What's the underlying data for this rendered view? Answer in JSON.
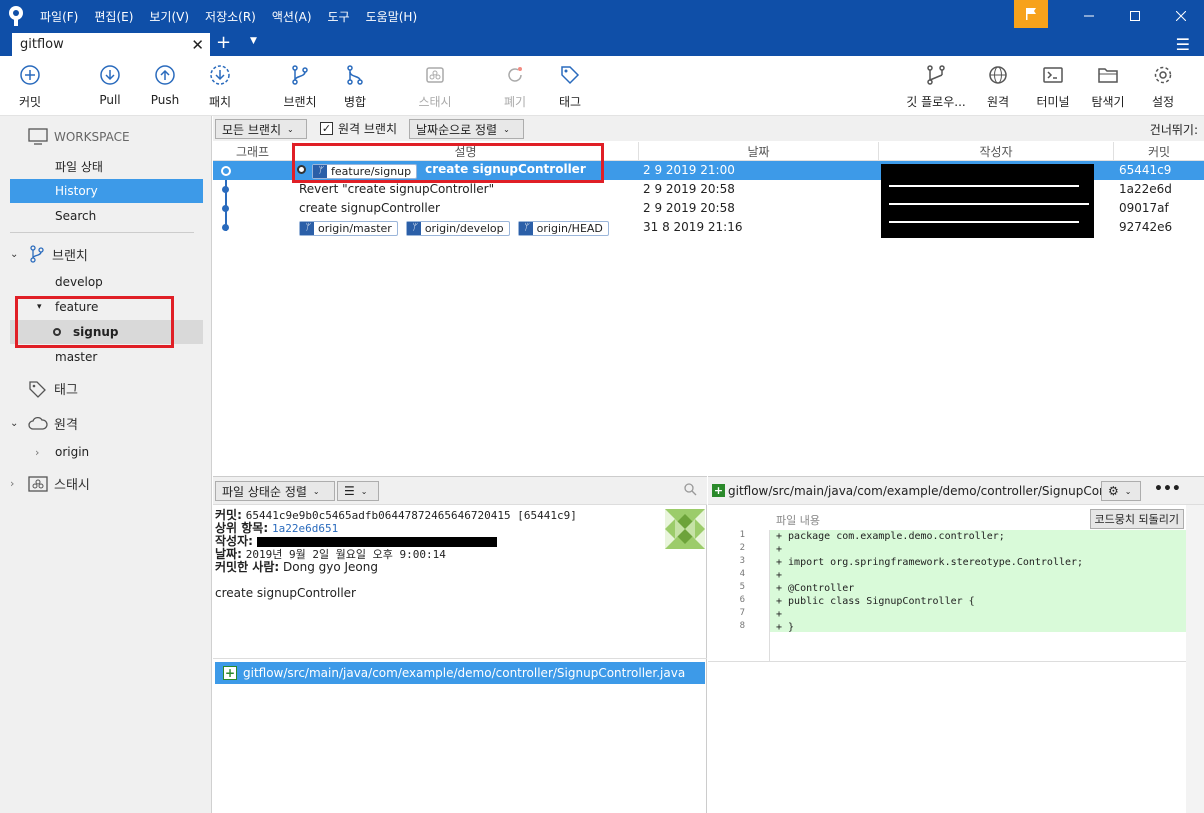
{
  "window": {
    "menu": [
      "파일(F)",
      "편집(E)",
      "보기(V)",
      "저장소(R)",
      "액션(A)",
      "도구",
      "도움말(H)"
    ]
  },
  "tabs": [
    {
      "label": "gitflow"
    }
  ],
  "toolbar": {
    "commit": "커밋",
    "pull": "Pull",
    "push": "Push",
    "fetch": "패치",
    "branch": "브랜치",
    "merge": "병합",
    "stash": "스태시",
    "discard": "폐기",
    "tag": "태그",
    "gitflow": "깃 플로우...",
    "remote": "원격",
    "terminal": "터미널",
    "explorer": "탐색기",
    "settings": "설정"
  },
  "sidebar": {
    "workspace": "WORKSPACE",
    "file_status": "파일 상태",
    "history": "History",
    "search": "Search",
    "branches_title": "브랜치",
    "branch_develop": "develop",
    "branch_feature": "feature",
    "branch_signup": "signup",
    "branch_master": "master",
    "tags_title": "태그",
    "remotes_title": "원격",
    "remote_origin": "origin",
    "stash_title": "스태시"
  },
  "filter": {
    "all_branches": "모든 브랜치",
    "remote_branches": "원격 브랜치",
    "remote_branches_checked": true,
    "sort": "날짜순으로 정렬",
    "skip": "건너뛰기:"
  },
  "columns": {
    "graph": "그래프",
    "description": "설명",
    "date": "날짜",
    "author": "작성자",
    "commit": "커밋"
  },
  "commits": [
    {
      "tag": "feature/signup",
      "message": "create signupController",
      "date": "2 9 2019 21:00",
      "hash": "65441c9"
    },
    {
      "message": "Revert \"create signupController\"",
      "date": "2 9 2019 20:58",
      "hash": "1a22e6d"
    },
    {
      "message": "create signupController",
      "date": "2 9 2019 20:58",
      "hash": "09017af"
    },
    {
      "tags": [
        "origin/master",
        "origin/develop",
        "origin/HEAD"
      ],
      "date": "31 8 2019 21:16",
      "hash": "92742e6"
    }
  ],
  "details": {
    "sort": "파일 상태순 정렬",
    "commit_label": "커밋:",
    "commit_value": "65441c9e9b0c5465adfb06447872465646720415 [65441c9]",
    "parent_label": "상위 항목:",
    "parent_value": "1a22e6d651",
    "author_label": "작성자:",
    "date_label": "날짜:",
    "date_value": "2019년 9월 2일 월요일 오후 9:00:14",
    "committer_label": "커밋한 사람:",
    "committer_value": "Dong gyo Jeong",
    "message": "create signupController",
    "file": "gitflow/src/main/java/com/example/demo/controller/SignupController.java"
  },
  "diff": {
    "path": "gitflow/src/main/java/com/example/demo/controller/SignupContro...",
    "file_content": "파일 내용",
    "revert_button": "코드뭉치 되돌리기",
    "lines": [
      {
        "n": "1",
        "text": "+ package com.example.demo.controller;"
      },
      {
        "n": "2",
        "text": "+"
      },
      {
        "n": "3",
        "text": "+ import org.springframework.stereotype.Controller;"
      },
      {
        "n": "4",
        "text": "+"
      },
      {
        "n": "5",
        "text": "+ @Controller"
      },
      {
        "n": "6",
        "text": "+ public class SignupController {"
      },
      {
        "n": "7",
        "text": "+"
      },
      {
        "n": "8",
        "text": "+ }"
      }
    ]
  },
  "colors": {
    "titlebar": "#0f4fa8",
    "selection": "#3d9ae8",
    "highlight_box": "#e01f26",
    "diff_added": "#d9fad9"
  }
}
